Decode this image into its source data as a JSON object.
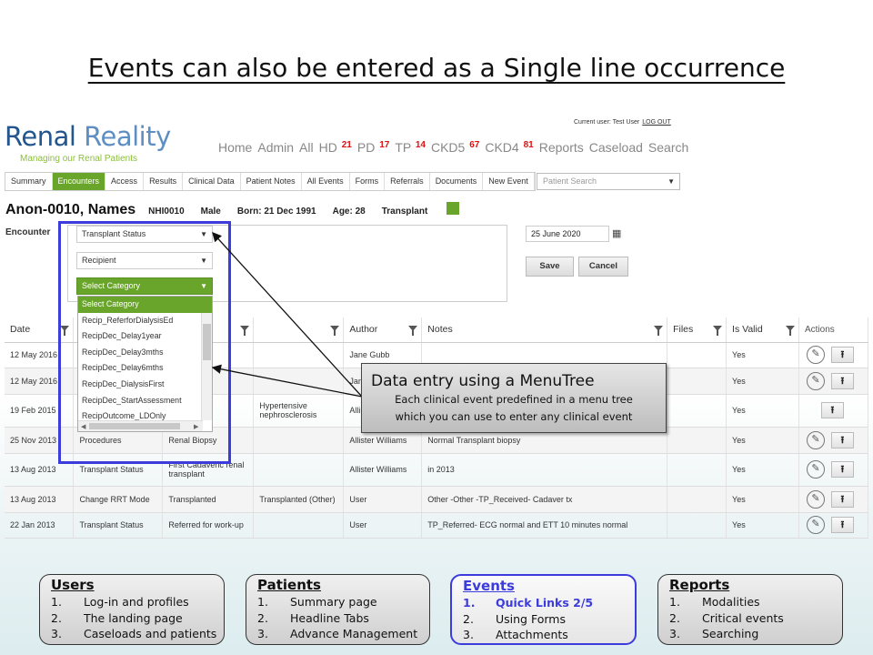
{
  "slide_title": "Events can also be entered as a Single line occurrence",
  "logo": {
    "main_1": "Renal",
    "main_2": " Reality",
    "sub": "Managing our Renal Patients"
  },
  "user_bar": {
    "current_user": "Current user: Test User",
    "logout": "LOG OUT"
  },
  "topnav": [
    {
      "label": "Home",
      "count": ""
    },
    {
      "label": "Admin",
      "count": ""
    },
    {
      "label": "All",
      "count": ""
    },
    {
      "label": "HD",
      "count": "21"
    },
    {
      "label": "PD",
      "count": "17"
    },
    {
      "label": "TP",
      "count": "14"
    },
    {
      "label": "CKD5",
      "count": "67"
    },
    {
      "label": "CKD4",
      "count": "81"
    },
    {
      "label": "Reports",
      "count": ""
    },
    {
      "label": "Caseload",
      "count": ""
    },
    {
      "label": "Search",
      "count": ""
    }
  ],
  "tabs": [
    "Summary",
    "Encounters",
    "Access",
    "Results",
    "Clinical Data",
    "Patient Notes",
    "All Events",
    "Forms",
    "Referrals",
    "Documents",
    "New Event"
  ],
  "patient_search": {
    "placeholder": "Patient Search"
  },
  "patient": {
    "name": "Anon-0010, Names",
    "nhi": "NHI0010",
    "sex": "Male",
    "born": "Born: 21 Dec 1991",
    "age": "Age: 28",
    "group": "Transplant"
  },
  "encounter": {
    "label": "Encounter",
    "select1": "Transplant Status",
    "select2": "Recipient",
    "select3": "Select Category",
    "date": "25 June 2020",
    "save": "Save",
    "cancel": "Cancel"
  },
  "dropdown_options": [
    "Select Category",
    "Recip_ReferforDialysisEd",
    "RecipDec_Delay1year",
    "RecipDec_Delay3mths",
    "RecipDec_Delay6mths",
    "RecipDec_DialysisFirst",
    "RecipDec_StartAssessment",
    "RecipOutcome_LDOnly"
  ],
  "table": {
    "headers": [
      "Date",
      "",
      "",
      "",
      "Author",
      "Notes",
      "Files",
      "Is Valid",
      "Actions"
    ],
    "rows": [
      {
        "date": "12 May 2016",
        "c1": "",
        "c2": "",
        "c3": "",
        "author": "Jane Gubb",
        "notes": "",
        "files": "",
        "valid": "Yes",
        "edit": true
      },
      {
        "date": "12 May 2016",
        "c1": "",
        "c2": "ill",
        "c3": "",
        "author": "Jan",
        "notes": "",
        "files": "",
        "valid": "Yes",
        "edit": true
      },
      {
        "date": "19 Feb 2015",
        "c1": "",
        "c2": "D",
        "c3": "Hypertensive nephrosclerosis",
        "author": "Alli",
        "notes": "",
        "files": "",
        "valid": "Yes",
        "edit": false
      },
      {
        "date": "25 Nov 2013",
        "c1": "Procedures",
        "c2": "Renal Biopsy",
        "c3": "",
        "author": "Allister Williams",
        "notes": "Normal Transplant biopsy",
        "files": "",
        "valid": "Yes",
        "edit": true
      },
      {
        "date": "13 Aug 2013",
        "c1": "Transplant Status",
        "c2": "First Cadaveric renal transplant",
        "c3": "",
        "author": "Allister Williams",
        "notes": "in 2013",
        "files": "",
        "valid": "Yes",
        "edit": true
      },
      {
        "date": "13 Aug 2013",
        "c1": "Change RRT Mode",
        "c2": "Transplanted",
        "c3": "Transplanted (Other)",
        "author": "User",
        "notes": "Other -Other -TP_Received- Cadaver tx",
        "files": "",
        "valid": "Yes",
        "edit": true
      },
      {
        "date": "22 Jan 2013",
        "c1": "Transplant Status",
        "c2": "Referred for work-up",
        "c3": "",
        "author": "User",
        "notes": "TP_Referred- ECG normal and ETT 10 minutes normal",
        "files": "",
        "valid": "Yes",
        "edit": true
      }
    ]
  },
  "callout": {
    "title": "Data entry using a MenuTree",
    "line1": "Each clinical event predefined in a menu tree",
    "line2": "which you can use to enter any clinical event"
  },
  "footer": [
    {
      "title": "Users",
      "items": [
        "Log-in and profiles",
        "The landing page",
        "Caseloads and patients"
      ]
    },
    {
      "title": "Patients",
      "items": [
        "Summary page",
        "Headline Tabs",
        "Advance Management"
      ]
    },
    {
      "title": "Events",
      "items": [
        "Quick Links 2/5",
        "Using Forms",
        "Attachments"
      ]
    },
    {
      "title": "Reports",
      "items": [
        "Modalities",
        "Critical events",
        "Searching"
      ]
    }
  ],
  "colors": {
    "brand_blue": "#23558f",
    "accent_green": "#6aa52b",
    "highlight_blue": "#3c3cdc",
    "alert_red": "#dd1111"
  }
}
